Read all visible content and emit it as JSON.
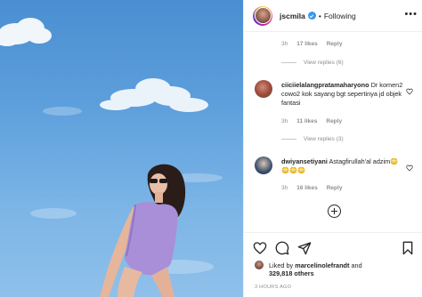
{
  "post": {
    "username": "jscmila",
    "follow_label": "Following",
    "header_separator": "•",
    "more_label": "•••"
  },
  "comments_top": {
    "meta": {
      "time": "3h",
      "likes": "17 likes",
      "reply": "Reply"
    },
    "view_replies": "View replies (6)"
  },
  "comments": [
    {
      "username": "ciiciielalangpratamaharyono",
      "text": "Dr komen2 cowo2 kok sayang bgt sepertinya jd objek fantasi",
      "time": "3h",
      "likes": "11 likes",
      "reply": "Reply",
      "view_replies": "View replies (3)"
    },
    {
      "username": "dwiyansetiyani",
      "text": "Astagfirullah'al adzim😳😳😳😳",
      "time": "3h",
      "likes": "16 likes",
      "reply": "Reply"
    }
  ],
  "footer": {
    "liked_prefix": "Liked by",
    "liked_user": "marcelinolefrandt",
    "liked_and": "and",
    "liked_count": "329,818 others",
    "time_ago": "3 HOURS AGO"
  },
  "icons": {
    "like": "heart-icon",
    "comment": "comment-icon",
    "share": "share-icon",
    "save": "bookmark-icon",
    "load_more": "plus-circle-icon",
    "verified": "verified-badge-icon"
  },
  "colors": {
    "sky": "#5d9fdc",
    "verified": "#3897f0",
    "swimsuit": "#a88fd8",
    "muted_text": "#8e8e8e"
  }
}
